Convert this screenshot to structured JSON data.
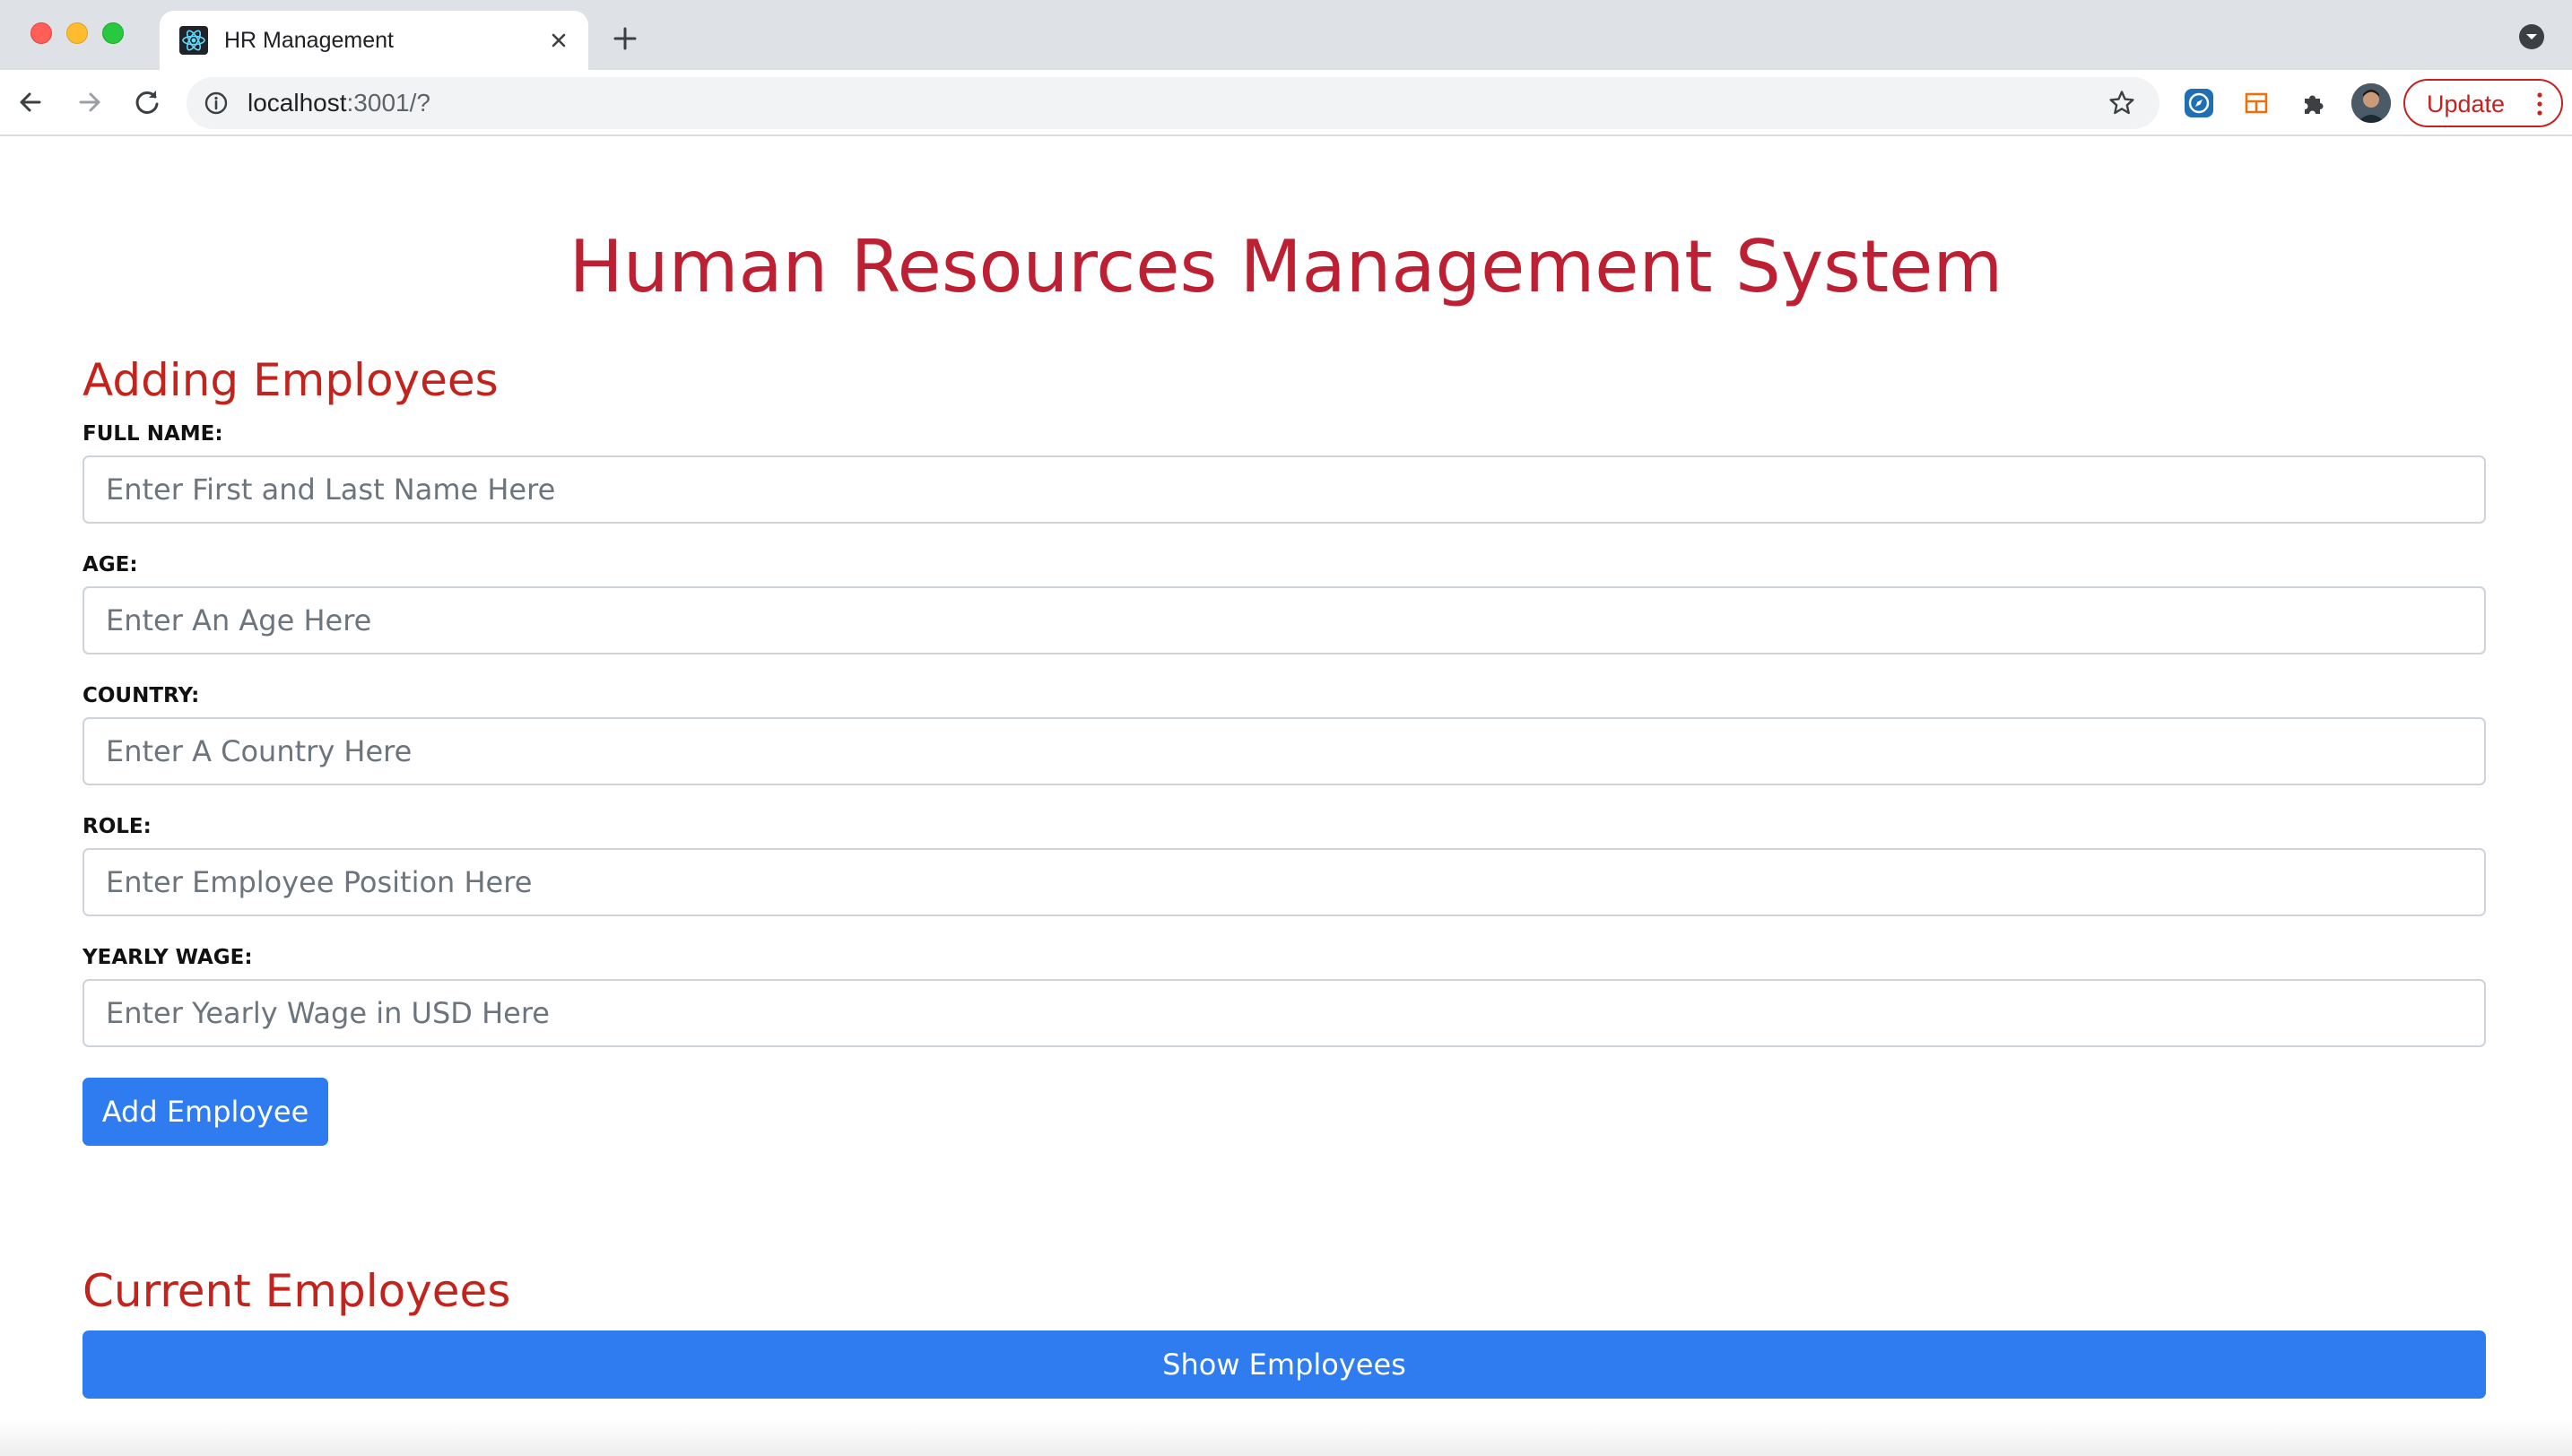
{
  "browser": {
    "tab_title": "HR Management",
    "url_host": "localhost",
    "url_rest": ":3001/?",
    "update_label": "Update",
    "icons": {
      "favicon": "react-logo-icon",
      "tab_close": "close-icon",
      "new_tab": "plus-icon",
      "tab_search": "chevron-down-circle-icon",
      "back": "arrow-left-icon",
      "forward": "arrow-right-icon",
      "reload": "reload-icon",
      "site_info": "info-icon",
      "bookmark": "star-icon",
      "ext_compass": "compass-icon",
      "ext_layout": "layout-icon",
      "ext_puzzle": "puzzle-icon",
      "menu": "kebab-menu-icon"
    },
    "colors": {
      "update_red": "#c5221f",
      "tab_strip": "#dee1e6"
    }
  },
  "page": {
    "title": "Human Resources Management System",
    "add_section": {
      "heading": "Adding Employees",
      "fields": [
        {
          "label": "FULL NAME:",
          "placeholder": "Enter First and Last Name Here",
          "value": ""
        },
        {
          "label": "AGE:",
          "placeholder": "Enter An Age Here",
          "value": ""
        },
        {
          "label": "COUNTRY:",
          "placeholder": "Enter A Country Here",
          "value": ""
        },
        {
          "label": "ROLE:",
          "placeholder": "Enter Employee Position Here",
          "value": ""
        },
        {
          "label": "YEARLY WAGE:",
          "placeholder": "Enter Yearly Wage in USD Here",
          "value": ""
        }
      ],
      "submit_label": "Add Employee"
    },
    "current_section": {
      "heading": "Current Employees",
      "show_label": "Show Employees"
    },
    "colors": {
      "title_red": "#bd2032",
      "heading_red": "#c2241d",
      "button_blue": "#2f7cf0"
    }
  }
}
